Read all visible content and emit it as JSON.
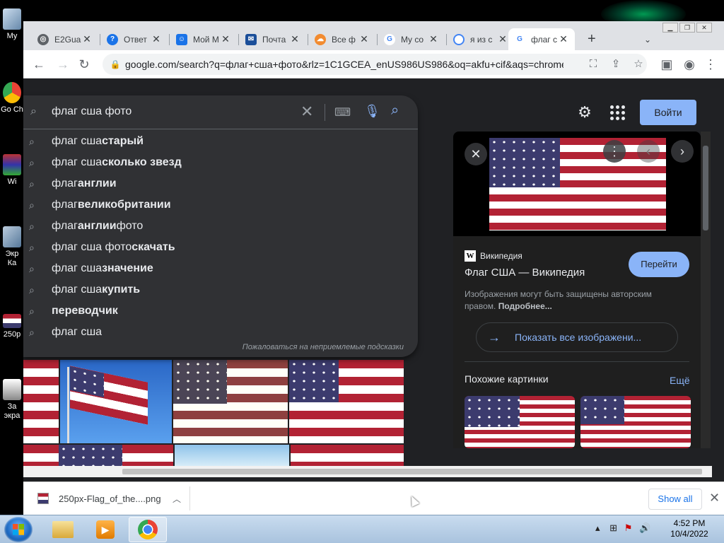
{
  "desktop": {
    "icons": [
      {
        "label": "My"
      },
      {
        "label": "Go Ch"
      },
      {
        "label": "Wi"
      },
      {
        "label": "Экр Ка"
      },
      {
        "label": "250p"
      },
      {
        "label": "За экра"
      }
    ]
  },
  "browser": {
    "tabs": [
      {
        "title": "E2Gua",
        "color": "#5f6368"
      },
      {
        "title": "Ответ",
        "color": "#1a73e8"
      },
      {
        "title": "Мой М",
        "color": "#1a73e8"
      },
      {
        "title": "Почта",
        "color": "#1a4e99"
      },
      {
        "title": "Все ф",
        "color": "#f28b30"
      },
      {
        "title": "My co",
        "color": "#4285f4"
      },
      {
        "title": "я из с",
        "color": "#4285f4"
      },
      {
        "title": "флаг с",
        "color": "#4285f4"
      }
    ],
    "new_tab": "+",
    "url": "google.com/search?q=флаг+сша+фото&rlz=1C1GCEA_enUS986US986&oq=akfu+cif&aqs=chrome.2...."
  },
  "search": {
    "query": "флаг сша фото",
    "suggestions": [
      {
        "plain": "флаг сша ",
        "bold": "старый",
        "tail": ""
      },
      {
        "plain": "флаг сша ",
        "bold": "сколько звезд",
        "tail": ""
      },
      {
        "plain": "флаг ",
        "bold": "англии",
        "tail": ""
      },
      {
        "plain": "флаг ",
        "bold": "великобритании",
        "tail": ""
      },
      {
        "plain": "флаг ",
        "bold": "англии",
        "tail": " фото"
      },
      {
        "plain": "флаг сша фото ",
        "bold": "скачать",
        "tail": ""
      },
      {
        "plain": "флаг сша ",
        "bold": "значение",
        "tail": ""
      },
      {
        "plain": "флаг сша ",
        "bold": "купить",
        "tail": ""
      },
      {
        "plain": "",
        "bold": "переводчик",
        "tail": ""
      },
      {
        "plain": "флаг сша",
        "bold": "",
        "tail": ""
      }
    ],
    "report_link": "Пожаловаться на неприемлемые подсказки"
  },
  "header": {
    "signin": "Войти"
  },
  "sidepanel": {
    "source": "Википедия",
    "title": "Флаг США — Википедия",
    "visit": "Перейти",
    "copyright_text": "Изображения могут быть защищены авторским правом.",
    "copyright_more": "Подробнее...",
    "show_all": "Показать все изображени...",
    "similar_title": "Похожие картинки",
    "more": "Ещё"
  },
  "downloads": {
    "file_name": "250px-Flag_of_the....png",
    "show_all": "Show all"
  },
  "taskbar": {
    "time": "4:52 PM",
    "date": "10/4/2022"
  }
}
